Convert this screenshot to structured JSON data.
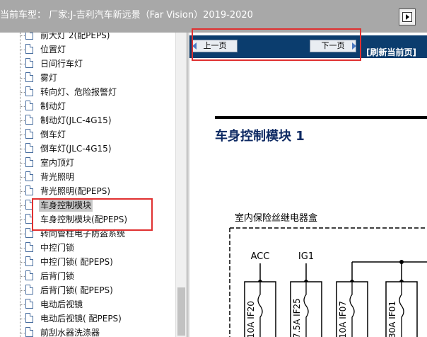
{
  "topbar": {
    "title": "当前车型： 厂家:J-吉利汽车新远景（Far Vision）2019-2020"
  },
  "tree": {
    "items": [
      {
        "label": "前大灯 2(配PEPS)"
      },
      {
        "label": "位置灯"
      },
      {
        "label": "日间行车灯"
      },
      {
        "label": "雾灯"
      },
      {
        "label": "转向灯、危险报警灯"
      },
      {
        "label": "制动灯"
      },
      {
        "label": "制动灯(JLC-4G15)"
      },
      {
        "label": "倒车灯"
      },
      {
        "label": "倒车灯(JLC-4G15)"
      },
      {
        "label": "室内顶灯"
      },
      {
        "label": "背光照明"
      },
      {
        "label": "背光照明(配PEPS)"
      },
      {
        "label": "车身控制模块",
        "selected": true
      },
      {
        "label": "车身控制模块(配PEPS)"
      },
      {
        "label": "转向管柱电子防盗系统"
      },
      {
        "label": "中控门锁"
      },
      {
        "label": "中控门锁( 配PEPS)"
      },
      {
        "label": "后背门锁"
      },
      {
        "label": "后背门锁( 配PEPS)"
      },
      {
        "label": "电动后视镜"
      },
      {
        "label": "电动后视镜( 配PEPS)"
      },
      {
        "label": "前刮水器洗涤器"
      }
    ]
  },
  "navbar": {
    "prev_label": "上一页",
    "next_label": "下一页",
    "refresh_label": "[刷新当前页]"
  },
  "document": {
    "title": "车身控制模块 1",
    "fuse_box_title": "室内保险丝继电器盒",
    "terminals": [
      "ACC",
      "IG1"
    ],
    "fuses": [
      {
        "label": "10A IF20"
      },
      {
        "label": "7.5A IF25"
      },
      {
        "label": "10A IF07"
      },
      {
        "label": "30A IF01"
      }
    ]
  },
  "colors": {
    "topbar_bg": "#a8a8a8",
    "navbar_bg": "#0b3d6e",
    "title_color": "#0e2a63",
    "highlight_red": "#e03030"
  }
}
